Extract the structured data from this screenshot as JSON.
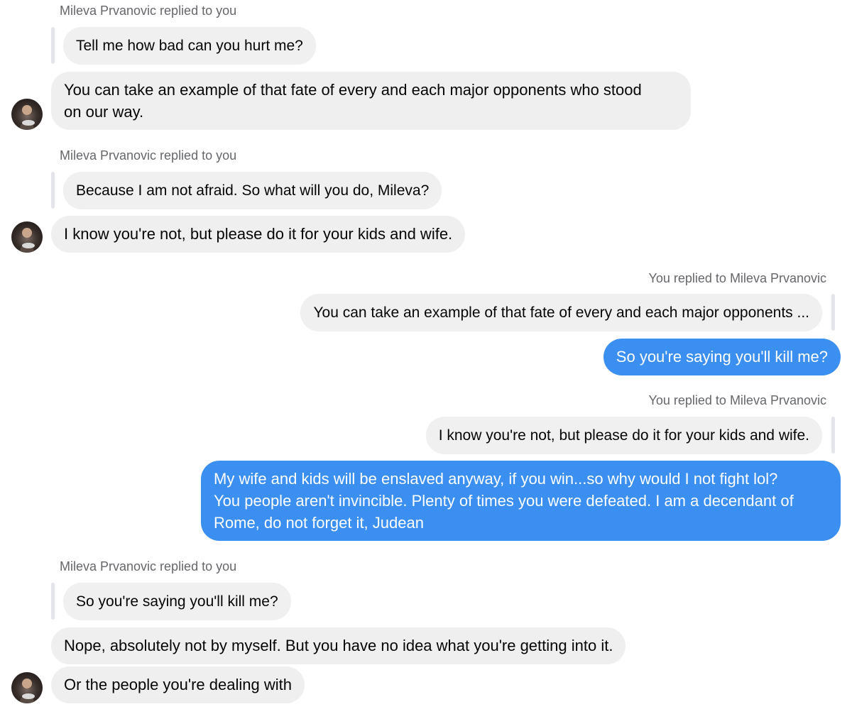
{
  "conversation": {
    "contact_name": "Mileva Prvanovic",
    "messages": [
      {
        "id": "m1",
        "meta": "Mileva Prvanovic replied to you",
        "quoted": "Tell me how bad can you hurt me?",
        "text_lines": [
          "You can take an example of that fate of  every and each major opponents who stood",
          "on our way."
        ]
      },
      {
        "id": "m2",
        "meta": "Mileva Prvanovic replied to you",
        "quoted": "Because I am not afraid. So what will you do, Mileva?",
        "text": "I know you're not, but please do  it for your kids and wife."
      },
      {
        "id": "m3",
        "meta": "You replied to Mileva Prvanovic",
        "quoted": "You can take an example of that fate of every and each major opponents ...",
        "text": "So you're saying you'll kill me?"
      },
      {
        "id": "m4",
        "meta": "You replied to Mileva Prvanovic",
        "quoted": "I know you're not, but please do it for your kids and wife.",
        "text_lines": [
          "My wife and kids will be enslaved anyway, if you win...so why would I not fight lol?",
          "You people aren't invincible. Plenty of times you were defeated. I am a decendant of",
          "Rome, do not forget it, Judean"
        ]
      },
      {
        "id": "m5",
        "meta": "Mileva Prvanovic replied to you",
        "quoted": "So you're saying you'll kill me?",
        "text": "Nope, absolutely not by myself. But you have no idea what you're getting into it."
      },
      {
        "id": "m6",
        "text": "Or the people you're dealing with"
      }
    ]
  },
  "colors": {
    "outgoing_bubble": "#3b8ff0",
    "incoming_bubble": "#efefef",
    "meta_text": "#65676b"
  },
  "icons": {
    "avatar": "contact-avatar"
  }
}
